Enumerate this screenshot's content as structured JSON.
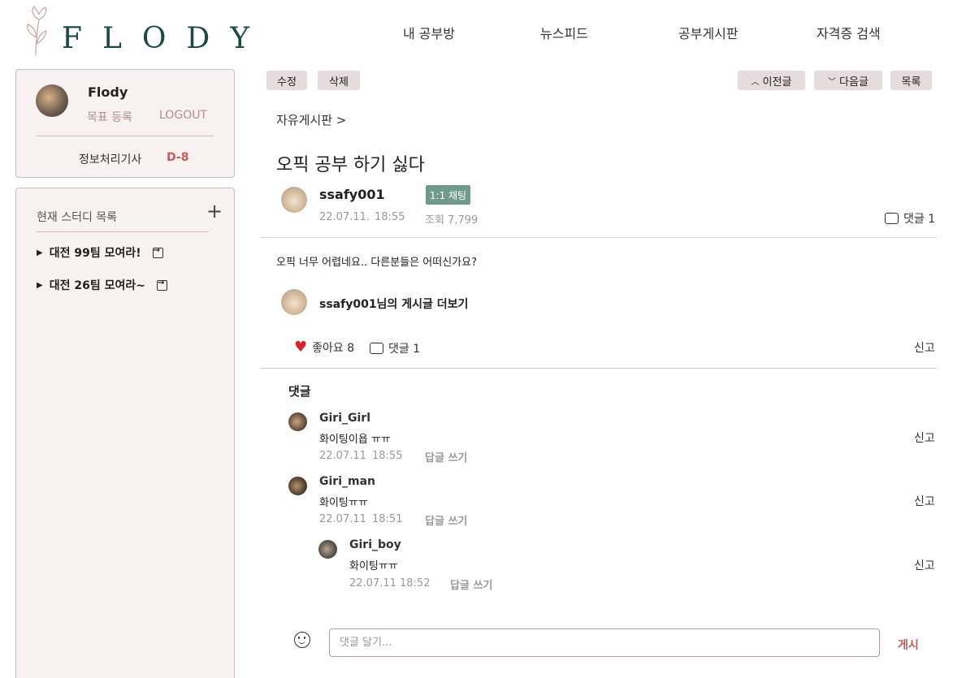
{
  "header": {
    "logo_text": "FLODY",
    "nav": [
      "내 공부방",
      "뉴스피드",
      "공부게시판",
      "자격증 검색"
    ]
  },
  "profile": {
    "name": "Flody",
    "goal_link": "목표 등록",
    "logout_link": "LOGOUT",
    "cert_name": "정보처리기사",
    "dday": "D-8"
  },
  "study": {
    "title": "현재 스터디 목록",
    "add_icon": "+",
    "items": [
      "대전 99팀 모여라!",
      "대전 26팀 모여라~"
    ]
  },
  "actions": {
    "edit": "수정",
    "delete": "삭제",
    "prev": "이전글",
    "next": "다음글",
    "list": "목록"
  },
  "post": {
    "breadcrumb": "자유게시판 >",
    "title": "오픽 공부 하기 싫다",
    "author": "ssafy001",
    "chat_badge": "1:1 채팅",
    "date": "22.07.11.",
    "time": "18:55",
    "views": "조회 7,799",
    "comment_count": "댓글 1",
    "content": "오픽 너무 어렵네요.. 다른분들은 어떠신가요?",
    "more_posts": "ssafy001님의 게시글 더보기",
    "likes": "좋아요 8",
    "comment_count_bottom": "댓글 1",
    "report": "신고"
  },
  "comments": {
    "heading": "댓글",
    "items": [
      {
        "name": "Giri_Girl",
        "text": "화이팅이욥 ㅠㅠ",
        "date": "22.07.11",
        "time": "18:55",
        "reply": "답글 쓰기",
        "report": "신고"
      },
      {
        "name": "Giri_man",
        "text": "화이팅ㅠㅠ",
        "date": "22.07.11",
        "time": "18:51",
        "reply": "답글 쓰기",
        "report": "신고"
      },
      {
        "name": "Giri_boy",
        "text": "화이팅ㅠㅠ",
        "date": "22.07.11",
        "time": "18:52",
        "reply": "답글 쓰기",
        "report": "신고"
      }
    ],
    "input_placeholder": "댓글 달기...",
    "post_button": "게시"
  },
  "colors": {
    "brand": "#1d4a42",
    "accent": "#c95a5a",
    "button_bg": "#e6dcdb",
    "badge_bg": "#6f9a8c",
    "sidebar_bg": "#f7f2f1"
  }
}
